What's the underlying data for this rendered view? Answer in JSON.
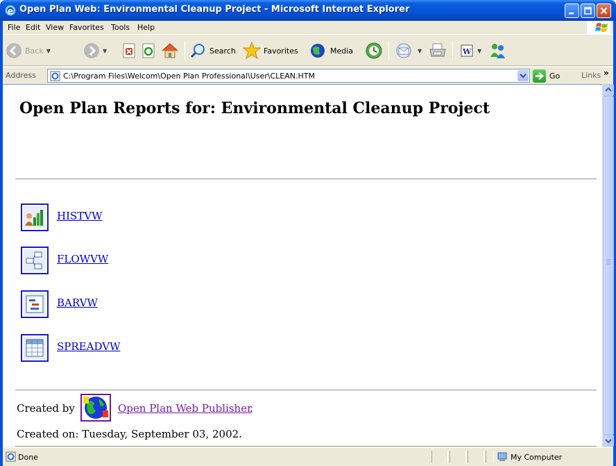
{
  "window": {
    "title": "Open Plan Web: Environmental Cleanup Project - Microsoft Internet Explorer"
  },
  "menu": [
    "File",
    "Edit",
    "View",
    "Favorites",
    "Tools",
    "Help"
  ],
  "toolbar": {
    "back_label": "Back",
    "search_label": "Search",
    "favorites_label": "Favorites",
    "media_label": "Media"
  },
  "address": {
    "label": "Address",
    "value": "C:\\Program Files\\Welcom\\Open Plan Professional\\User\\CLEAN.HTM",
    "go_label": "Go",
    "links_label": "Links",
    "links_chevron": "»"
  },
  "page": {
    "title": "Open Plan Reports for: Environmental Cleanup Project",
    "reports": [
      {
        "label": "HISTVW",
        "icon": "histogram-report-icon"
      },
      {
        "label": "FLOWVW",
        "icon": "flow-report-icon"
      },
      {
        "label": "BARVW",
        "icon": "bar-chart-report-icon"
      },
      {
        "label": "SPREADVW",
        "icon": "spreadsheet-report-icon"
      }
    ],
    "created_by_label": "Created by",
    "publisher_link": "Open Plan Web Publisher",
    "publisher_period": ".",
    "created_on": "Created on: Tuesday, September 03, 2002."
  },
  "status": {
    "text": "Done",
    "zone": "My Computer"
  },
  "colors": {
    "titlebar": "#0553d7",
    "link": "#0000cc",
    "visited_link": "#7a1aa0",
    "chrome": "#ece9d8"
  }
}
